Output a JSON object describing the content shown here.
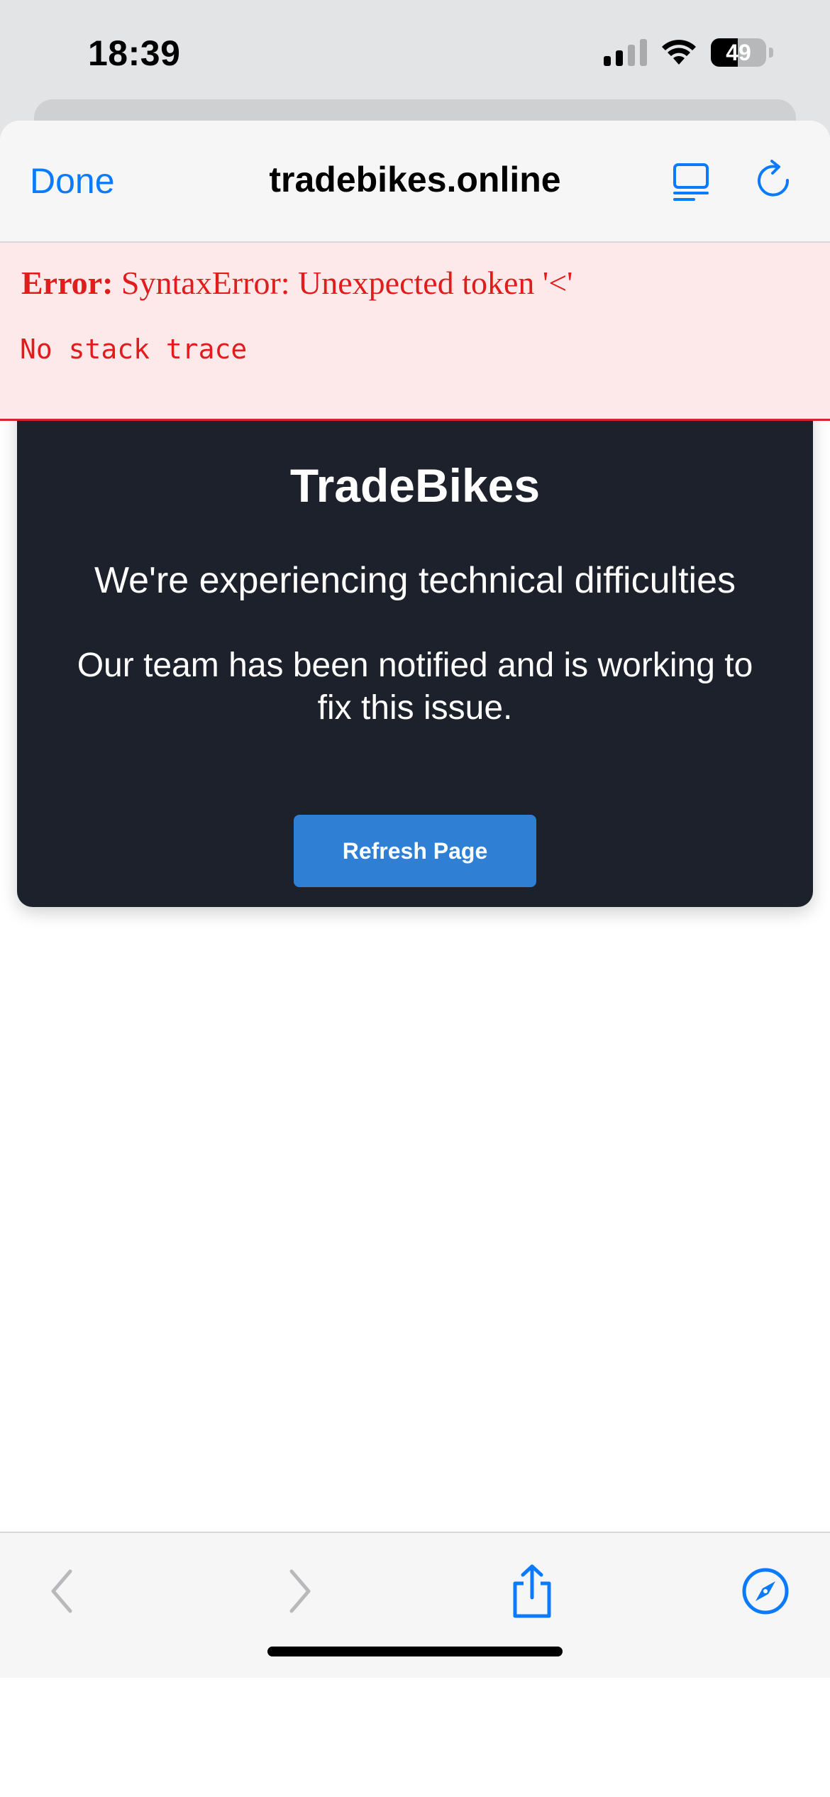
{
  "status_bar": {
    "time": "18:39",
    "battery_level": "49",
    "battery_fraction": 0.49
  },
  "nav": {
    "done_label": "Done",
    "title": "tradebikes.online"
  },
  "error_overlay": {
    "prefix": "Error:",
    "message": "SyntaxError: Unexpected token '<'",
    "stack": "No stack trace"
  },
  "error_card": {
    "brand": "TradeBikes",
    "headline": "We're experiencing technical difficulties",
    "message": "Our team has been notified and is working to fix this issue.",
    "button_label": "Refresh Page"
  },
  "toolbar": {
    "items": [
      "back-icon",
      "forward-icon",
      "share-icon",
      "compass-icon"
    ]
  },
  "colors": {
    "accent": "#0a7aff",
    "error_text": "#e01c1c",
    "error_bg": "#fde9e9",
    "card_bg": "#1d212b",
    "button_bg": "#2f80d4"
  }
}
